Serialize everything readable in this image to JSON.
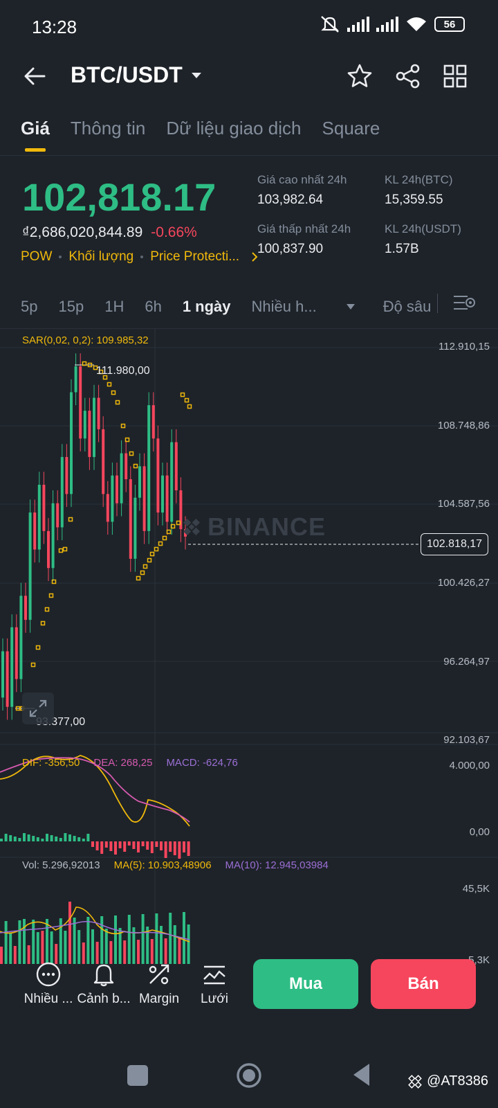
{
  "status": {
    "time": "13:28",
    "battery": "56"
  },
  "header": {
    "pair": "BTC/USDT"
  },
  "tabs": [
    {
      "label": "Giá"
    },
    {
      "label": "Thông tin"
    },
    {
      "label": "Dữ liệu giao dịch"
    },
    {
      "label": "Square"
    }
  ],
  "ticker": {
    "last_price": "102,818.17",
    "local_price": "₫2,686,020,844.89",
    "change_pct": "-0.66%",
    "tag_pow": "POW",
    "tag_volume": "Khối lượng",
    "tag_protection": "Price Protecti...",
    "high_label": "Giá cao nhất 24h",
    "high_value": "103,982.64",
    "low_label": "Giá thấp nhất 24h",
    "low_value": "100,837.90",
    "vol_btc_label": "KL 24h(BTC)",
    "vol_btc_value": "15,359.55",
    "vol_usdt_label": "KL 24h(USDT)",
    "vol_usdt_value": "1.57B"
  },
  "intervals": {
    "items": [
      "5p",
      "15p",
      "1H",
      "6h",
      "1 ngày"
    ],
    "more": "Nhiều h...",
    "depth": "Độ sâu"
  },
  "chart": {
    "sar_label": "SAR(0,02, 0,2): 109.985,32",
    "watermark": "BINANCE",
    "high_marker": "111.980,00",
    "low_marker": "93.377,00",
    "price_tag": "102.818,17",
    "y_ticks": [
      "112.910,15",
      "108.748,86",
      "104.587,56",
      "100.426,27",
      "96.264,97",
      "92.103,67"
    ],
    "macd_dif": "DIF: -356,50",
    "macd_dea": "DEA: 268,25",
    "macd_val": "MACD: -624,76",
    "macd_ticks": [
      "4.000,00",
      "0,00"
    ],
    "vol_label": "Vol: 5.296,92013",
    "vol_ma5": "MA(5): 10.903,48906",
    "vol_ma10": "MA(10): 12.945,03984",
    "vol_ticks": [
      "45,5K",
      "5,3K"
    ],
    "colors": {
      "up": "#2ebd85",
      "down": "#f6465d",
      "sar": "#f0b90b",
      "dea": "#d65ab0",
      "macd": "#9b6fd6"
    }
  },
  "bottom_nav": [
    {
      "label": "Nhiều ...",
      "icon": "more-icon"
    },
    {
      "label": "Cảnh b...",
      "icon": "bell-icon"
    },
    {
      "label": "Margin",
      "icon": "margin-icon"
    },
    {
      "label": "Lưới",
      "icon": "grid-trading-icon"
    }
  ],
  "actions": {
    "buy": "Mua",
    "sell": "Bán"
  },
  "footer": {
    "user": "@AT8386"
  }
}
